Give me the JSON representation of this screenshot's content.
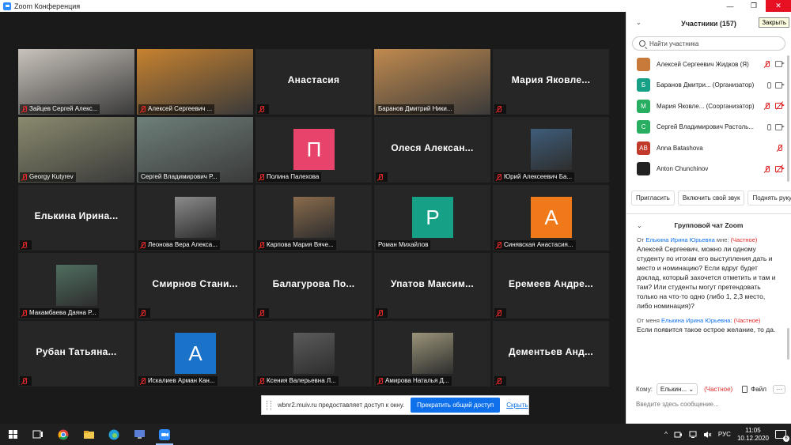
{
  "window": {
    "title": "Zoom Конференция",
    "minimize": "—",
    "restore": "❐",
    "close": "✕"
  },
  "tiles": [
    {
      "kind": "photo",
      "label": "Зайцев Сергей Алекс...",
      "muted": true,
      "bg": "#c9c3bb"
    },
    {
      "kind": "photo",
      "label": "Алексей Сергеевич ...",
      "muted": true,
      "bg": "#c7822f"
    },
    {
      "kind": "name",
      "big": "Анастасия",
      "label": "",
      "muted": true
    },
    {
      "kind": "photo",
      "label": "Баранов Дмитрий Ники...",
      "muted": false,
      "bg": "#c08a4e",
      "active": true
    },
    {
      "kind": "name",
      "big": "Мария Яковле...",
      "label": "",
      "muted": true
    },
    {
      "kind": "photo",
      "label": "Georgy Kutyrev",
      "muted": true,
      "bg": "#8a8a6e"
    },
    {
      "kind": "photo",
      "label": "Сергей Владимирович Р...",
      "muted": false,
      "bg": "#6e7f7a"
    },
    {
      "kind": "avatar",
      "letter": "П",
      "color": "#e8436b",
      "label": "Полина Палехова",
      "muted": true
    },
    {
      "kind": "name",
      "big": "Олеся Алексан...",
      "label": "",
      "muted": true
    },
    {
      "kind": "smallphoto",
      "label": "Юрий Алексеевич Ба...",
      "muted": true,
      "bg": "#3e5d7a"
    },
    {
      "kind": "name",
      "big": "Елькина Ирина...",
      "label": "",
      "muted": true
    },
    {
      "kind": "smallphoto",
      "label": "Леонова Вера Алекса...",
      "muted": true,
      "bg": "#8b8b8b"
    },
    {
      "kind": "smallphoto",
      "label": "Карпова Мария Вяче...",
      "muted": true,
      "bg": "#8a6b4c"
    },
    {
      "kind": "avatar",
      "letter": "Р",
      "color": "#16a085",
      "label": "Роман Михайлов",
      "muted": false
    },
    {
      "kind": "avatar",
      "letter": "А",
      "color": "#f07a1a",
      "label": "Синявская Анастасия...",
      "muted": true
    },
    {
      "kind": "smallphoto",
      "label": "Макамбаева Даяна Р...",
      "muted": true,
      "bg": "#4f6f60"
    },
    {
      "kind": "name",
      "big": "Смирнов Стани...",
      "label": "",
      "muted": true
    },
    {
      "kind": "name",
      "big": "Балагурова По...",
      "label": "",
      "muted": true
    },
    {
      "kind": "name",
      "big": "Упатов Максим...",
      "label": "",
      "muted": true
    },
    {
      "kind": "name",
      "big": "Еремеев Андре...",
      "label": "",
      "muted": true
    },
    {
      "kind": "name",
      "big": "Рубан Татьяна...",
      "label": "",
      "muted": true
    },
    {
      "kind": "avatar",
      "letter": "А",
      "color": "#1a73c9",
      "label": "Искалиев Арман Кан...",
      "muted": true
    },
    {
      "kind": "smallphoto",
      "label": "Ксения Валерьевна Л...",
      "muted": true,
      "bg": "#5b5b5b"
    },
    {
      "kind": "smallphoto",
      "label": "Амирова Наталья Д...",
      "muted": true,
      "bg": "#9a9478"
    },
    {
      "kind": "name",
      "big": "Дементьев Анд...",
      "label": "",
      "muted": true
    }
  ],
  "share_bar": {
    "message": "wbnr2.muiv.ru предоставляет доступ к окну.",
    "stop": "Прекратить общий доступ",
    "hide": "Скрыть"
  },
  "participants": {
    "title": "Участники (157)",
    "tooltip": "Закрыть",
    "search_placeholder": "Найти участника",
    "list": [
      {
        "name": "Алексей Сергеевич Жидков (Я)",
        "avatar_letter": "",
        "avatar_color": "#c77a3a",
        "mic": "off",
        "cam": "on"
      },
      {
        "name": "Баранов Дмитри... (Организатор)",
        "avatar_letter": "Б",
        "avatar_color": "#16a085",
        "mic": "on",
        "cam": "on"
      },
      {
        "name": "Мария Яковле... (Соорганизатор)",
        "avatar_letter": "М",
        "avatar_color": "#27ae60",
        "mic": "off",
        "cam": "off"
      },
      {
        "name": "Сергей Владимирович Растоль...",
        "avatar_letter": "С",
        "avatar_color": "#27ae60",
        "mic": "on",
        "cam": "on"
      },
      {
        "name": "Anna Batashova",
        "avatar_letter": "AB",
        "avatar_color": "#c0392b",
        "mic": "off",
        "cam": "none"
      },
      {
        "name": "Anton Chunchinov",
        "avatar_letter": "",
        "avatar_color": "#222222",
        "mic": "off",
        "cam": "off"
      },
      {
        "name": "Georgy Kutyrev",
        "avatar_letter": "",
        "avatar_color": "#777777",
        "mic": "off",
        "cam": "off"
      }
    ],
    "invite": "Пригласить",
    "unmute": "Включить свой звук",
    "raise": "Поднять руку"
  },
  "chat": {
    "title": "Групповой чат Zoom",
    "messages": [
      {
        "from": "От",
        "who": "Елькина Ирина Юрьевна",
        "to": "мне:",
        "priv": "(Частное)",
        "text": "Алексей Сергеевич, можно ли одному студенту по итогам его выступления дать и место и номинацию?  Если вдруг будет доклад, который захочется отметить и там и там? Или студенты могут претендовать только на что-то одно (либо 1, 2,3 место, либо номинация)?"
      },
      {
        "from": "От меня",
        "who": "Елькина Ирина Юрьевна:",
        "to": "",
        "priv": "(Частное)",
        "text": "Если появится такое острое желание, то да."
      }
    ],
    "to_label": "Кому:",
    "to_value": "Елькин...",
    "private": "(Частное)",
    "file": "Файл",
    "more": "···",
    "input_placeholder": "Введите здесь сообщение..."
  },
  "taskbar": {
    "lang": "РУС",
    "time": "11:05",
    "date": "10.12.2020",
    "notifications": "6"
  }
}
